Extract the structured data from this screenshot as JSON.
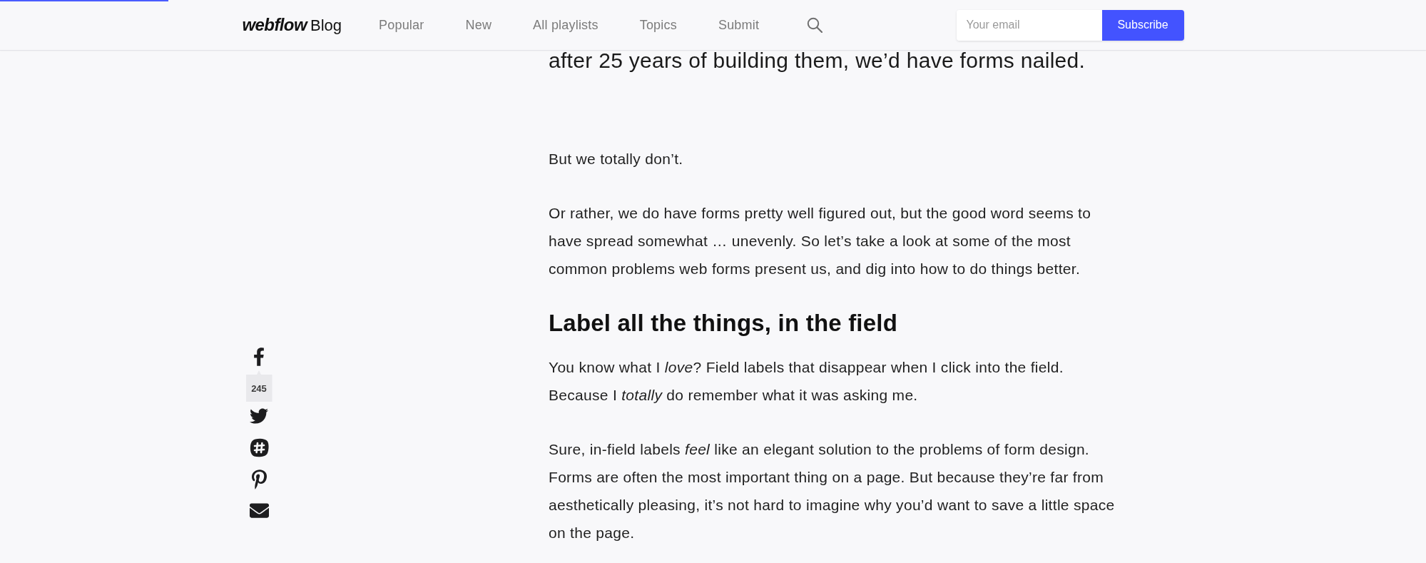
{
  "reading_progress": {
    "level": 0.118
  },
  "header": {
    "logo": {
      "wordmark": "webflow",
      "label": "Blog"
    },
    "nav": [
      {
        "label": "Popular",
        "selected": false
      },
      {
        "label": "New",
        "selected": false
      },
      {
        "label": "All playlists",
        "selected": false
      },
      {
        "label": "Topics",
        "selected": false
      },
      {
        "label": "Submit",
        "selected": false
      }
    ],
    "email_field": {
      "placeholder": "Your email"
    },
    "subscribe_button": "Subscribe"
  },
  "share_bar": [
    {
      "kind": "facebook",
      "count": "245"
    },
    {
      "kind": "twitter"
    },
    {
      "kind": "slack"
    },
    {
      "kind": "pinterest"
    },
    {
      "kind": "email"
    }
  ],
  "article": {
    "blocks": [
      {
        "kind": "lead",
        "text": "after 25 years of building them, we’d have forms nailed."
      },
      {
        "kind": "paragraph",
        "text": "But we totally don’t."
      },
      {
        "kind": "paragraph",
        "text": "Or rather, we do have forms pretty well figured out, but the good word seems to have spread somewhat … unevenly. So let’s take a look at some of the most common problems web forms present us, and dig into how to do things better."
      },
      {
        "kind": "heading",
        "text": "Label all the things, in the field"
      },
      {
        "kind": "paragraph",
        "text": "You know what I *love*? Field labels that disappear when I click into the field. Because I *totally* do remember what it was asking me."
      },
      {
        "kind": "paragraph",
        "text": "Sure, in-field labels *feel* like an elegant solution to the problems of form design. Forms are often the most important thing on a page. But because they’re far from aesthetically pleasing, it’s not hard to imagine why you’d want to save a little space on the page."
      }
    ]
  }
}
